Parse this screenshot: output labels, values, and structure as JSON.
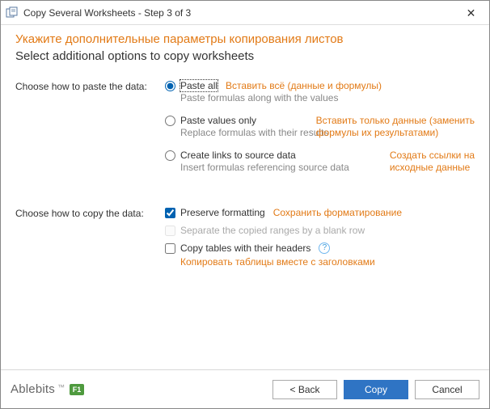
{
  "window": {
    "title": "Copy Several Worksheets - Step 3 of 3"
  },
  "headers": {
    "annotation": "Укажите дополнительные параметры копирования листов",
    "main": "Select additional options to copy worksheets"
  },
  "sections": {
    "paste": {
      "label": "Choose how to paste the data:",
      "options": {
        "paste_all": {
          "label": "Paste all",
          "desc": "Paste formulas along with the values",
          "annot": "Вставить всё (данные и формулы)",
          "selected": true
        },
        "values_only": {
          "label": "Paste values only",
          "desc": "Replace formulas with their results",
          "annot_line1": "Вставить только данные (заменить",
          "annot_line2": "формулы их результатами)",
          "selected": false
        },
        "links": {
          "label": "Create links to source data",
          "desc": "Insert formulas referencing source data",
          "annot_line1": "Создать ссылки на",
          "annot_line2": "исходные данные",
          "selected": false
        }
      }
    },
    "copy": {
      "label": "Choose how to copy the data:",
      "options": {
        "preserve": {
          "label": "Preserve formatting",
          "annot": "Сохранить форматирование",
          "checked": true
        },
        "separate": {
          "label": "Separate the copied ranges by a blank row",
          "checked": false,
          "disabled": true
        },
        "tables_headers": {
          "label": "Copy tables with their headers",
          "annot": "Копировать таблицы вместе с заголовками",
          "checked": false
        }
      }
    }
  },
  "footer": {
    "brand": "Ablebits",
    "badge": "F1",
    "back": "<  Back",
    "copy": "Copy",
    "cancel": "Cancel"
  }
}
